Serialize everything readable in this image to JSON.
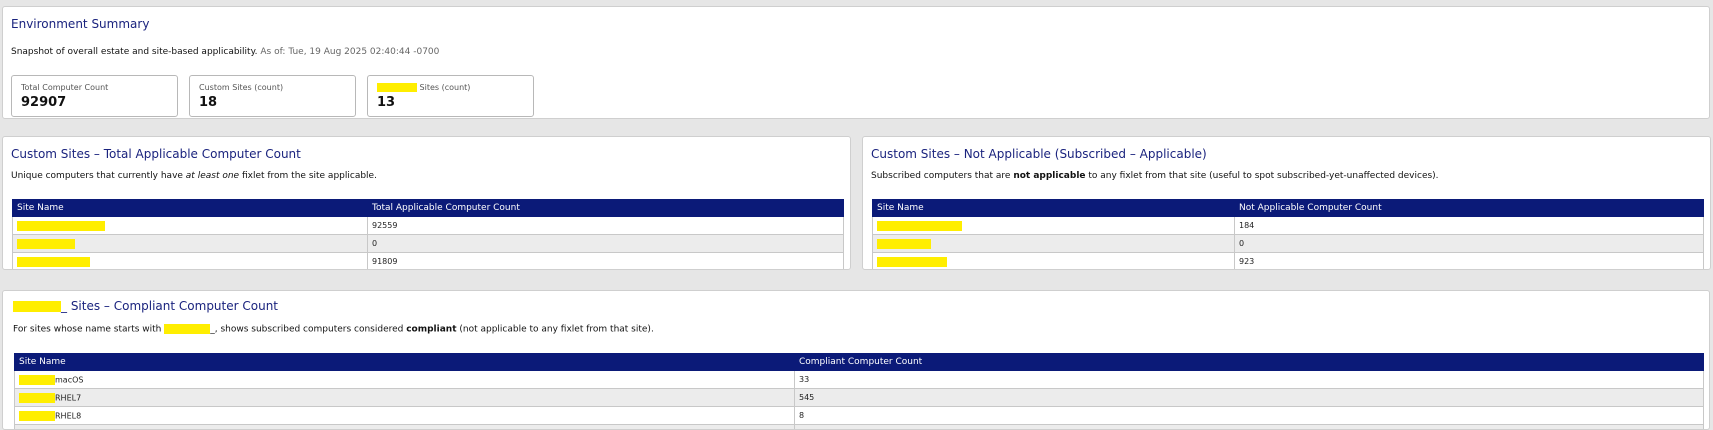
{
  "summary": {
    "title": "Environment Summary",
    "desc": "Snapshot of overall estate and site-based applicability.",
    "asof": "As of: Tue, 19 Aug 2025 02:40:44 -0700",
    "cards": [
      {
        "label": "Total Computer Count",
        "value": "92907"
      },
      {
        "label": "Custom Sites (count)",
        "value": "18"
      },
      {
        "label": "Sites (count)",
        "value": "13"
      }
    ]
  },
  "custom_applicable": {
    "title": "Custom Sites – Total Applicable Computer Count",
    "desc_pre": "Unique computers that currently have ",
    "desc_em": "at least one",
    "desc_post": " fixlet from the site applicable.",
    "col1": "Site Name",
    "col2": "Total Applicable Computer Count",
    "rows": [
      {
        "name": "",
        "value": "92559"
      },
      {
        "name": "",
        "value": "0"
      },
      {
        "name": "",
        "value": "91809"
      }
    ]
  },
  "custom_not_applicable": {
    "title": "Custom Sites – Not Applicable (Subscribed – Applicable)",
    "desc_pre": "Subscribed computers that are ",
    "desc_strong": "not applicable",
    "desc_post": " to any fixlet from that site (useful to spot subscribed-yet-unaffected devices).",
    "col1": "Site Name",
    "col2": "Not Applicable Computer Count",
    "rows": [
      {
        "name": "",
        "value": "184"
      },
      {
        "name": "",
        "value": "0"
      },
      {
        "name": "",
        "value": "923"
      }
    ]
  },
  "compliant": {
    "title": "_ Sites – Compliant Computer Count",
    "desc_pre": "For sites whose name starts with ",
    "desc_mid": "_, shows subscribed computers considered ",
    "desc_strong": "compliant",
    "desc_post": " (not applicable to any fixlet from that site).",
    "col1": "Site Name",
    "col2": "Compliant Computer Count",
    "rows": [
      {
        "name": "macOS",
        "value": "33"
      },
      {
        "name": "RHEL7",
        "value": "545"
      },
      {
        "name": "RHEL8",
        "value": "8"
      }
    ]
  },
  "colors": {
    "header_bg": "#0b1a78",
    "title": "#1a237e",
    "redaction": "#ffee00"
  }
}
